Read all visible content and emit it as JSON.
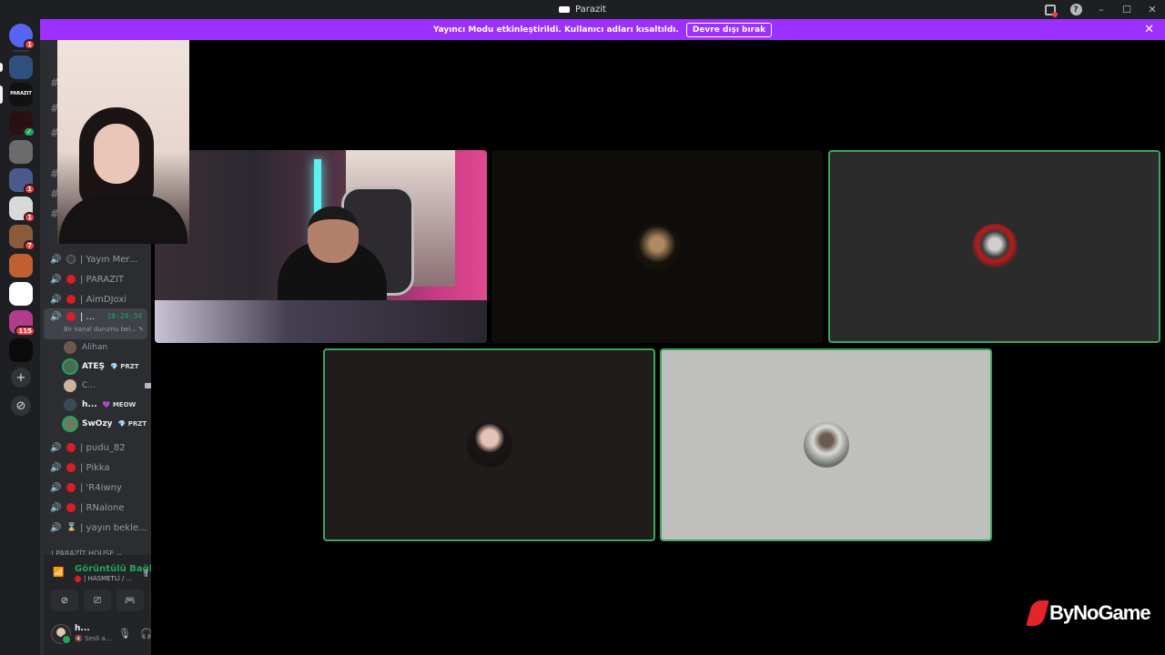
{
  "window": {
    "title": "Parazit",
    "buttons": {
      "minimize": "–",
      "maximize": "☐",
      "close": "✕"
    }
  },
  "banner": {
    "message": "Yayıncı Modu etkinleştirildi. Kullanıcı adları kısaltıldı.",
    "disable_label": "Devre dışı bırak",
    "close": "✕"
  },
  "rail": {
    "servers": [
      {
        "name": "discord-home",
        "color": "#5865f2",
        "badge": "1"
      },
      {
        "name": "server-1",
        "color": "#2f4f7f",
        "badge": ""
      },
      {
        "name": "parazit",
        "label": "PARAZIT",
        "color": "#111111",
        "badge": ""
      },
      {
        "name": "server-3",
        "color": "#2a1010",
        "badge": "✓"
      },
      {
        "name": "server-4",
        "color": "#6b6b6b",
        "badge": ""
      },
      {
        "name": "server-5",
        "color": "#4b5a8a",
        "badge": "1"
      },
      {
        "name": "server-6",
        "color": "#d9d9d9",
        "badge": "1"
      },
      {
        "name": "server-7",
        "color": "#8a5a3a",
        "badge": "7"
      },
      {
        "name": "server-8",
        "color": "#c06030",
        "badge": ""
      },
      {
        "name": "server-9",
        "color": "#ffffff",
        "badge": ""
      },
      {
        "name": "server-10",
        "color": "#b03c8c",
        "badge": "115"
      },
      {
        "name": "server-11",
        "color": "#0b0b0b",
        "badge": ""
      }
    ],
    "add": "+",
    "discover": "⊘"
  },
  "channels": {
    "voice": [
      {
        "label": "| Yayın Mer...",
        "dot": "dim"
      },
      {
        "label": "| PARAZIT",
        "dot": "red"
      },
      {
        "label": "| AimDJoxi",
        "dot": "red"
      },
      {
        "label": "| ...",
        "dot": "red",
        "active": true,
        "time": "10:24:34",
        "status": "Bir kanal durumu bel..."
      },
      {
        "label": "| pudu_82",
        "dot": "red"
      },
      {
        "label": "| Pikka",
        "dot": "red"
      },
      {
        "label": "| 'R4iwny",
        "dot": "red"
      },
      {
        "label": "| RNalone",
        "dot": "red"
      },
      {
        "label": "| yayın bekle...",
        "dot": "hourglass"
      }
    ],
    "members": [
      {
        "name": "Alihan",
        "tag": "",
        "speaking": false,
        "bold": false
      },
      {
        "name": "ATEŞ",
        "tag": "💎 PRZT",
        "speaking": true,
        "bold": true
      },
      {
        "name": "C...",
        "tag": "",
        "speaking": false,
        "bold": false,
        "camera": true
      },
      {
        "name": "h...",
        "tag": "💜 MEOW",
        "speaking": false,
        "bold": true
      },
      {
        "name": "SwOzy",
        "tag": "💎 PRZT",
        "speaking": true,
        "bold": true
      }
    ],
    "category": "| PARAZİT HOUSE ⌄"
  },
  "voice_panel": {
    "title": "Görüntülü Bağl",
    "subtitle": "| HASMETLİ / ...",
    "user_name": "h...",
    "user_status": "🔇 Sesli a..."
  },
  "tiles": [
    {
      "name": "stream-tile",
      "speaking": false
    },
    {
      "name": "participant-tile-2",
      "speaking": false,
      "bg": "#0f0d0a"
    },
    {
      "name": "participant-tile-3",
      "speaking": true,
      "bg": "#2b2b2b"
    },
    {
      "name": "participant-tile-4",
      "speaking": true,
      "bg": "#201c1c"
    },
    {
      "name": "participant-tile-5",
      "speaking": true,
      "bg": "#bfc0bd"
    }
  ],
  "watermark": {
    "text": "ByNoGame"
  },
  "colors": {
    "accent_banner": "#9b30ff",
    "speaking": "#3ba55c",
    "live_dot": "#da1e28"
  }
}
